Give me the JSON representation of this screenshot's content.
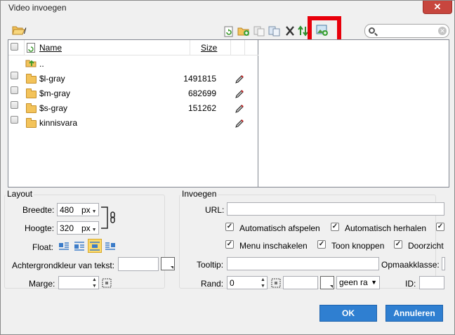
{
  "window": {
    "title": "Video invoegen",
    "close_label": "✕"
  },
  "toolbar": {
    "path": "/"
  },
  "search": {
    "value": "",
    "placeholder": ""
  },
  "file_list": {
    "columns": {
      "name": "Name",
      "size": "Size"
    },
    "parent": "..",
    "rows": [
      {
        "name": "$l-gray",
        "size": "1491815"
      },
      {
        "name": "$m-gray",
        "size": "682699"
      },
      {
        "name": "$s-gray",
        "size": "151262"
      },
      {
        "name": "kinnisvara",
        "size": ""
      }
    ]
  },
  "layout_group": {
    "title": "Layout",
    "width_label": "Breedte:",
    "width_value": "480",
    "width_unit": "px",
    "height_label": "Hoogte:",
    "height_value": "320",
    "height_unit": "px",
    "float_label": "Float:",
    "bgcolor_label": "Achtergrondkleur van tekst:",
    "margin_label": "Marge:"
  },
  "insert_group": {
    "title": "Invoegen",
    "url_label": "URL:",
    "autoplay_label": "Automatisch afspelen",
    "loop_label": "Automatisch herhalen",
    "menu_label": "Menu inschakelen",
    "buttons_label": "Toon knoppen",
    "transparent_label": "Doorzicht",
    "tooltip_label": "Tooltip:",
    "cssclass_label": "Opmaakklasse:",
    "border_label": "Rand:",
    "border_value": "0",
    "border_style": "geen ra",
    "id_label": "ID:"
  },
  "footer": {
    "ok_label": "OK",
    "cancel_label": "Annuleren"
  },
  "colors": {
    "highlight": "#e8000b",
    "button": "#2f7fd1",
    "close": "#c7463e"
  }
}
